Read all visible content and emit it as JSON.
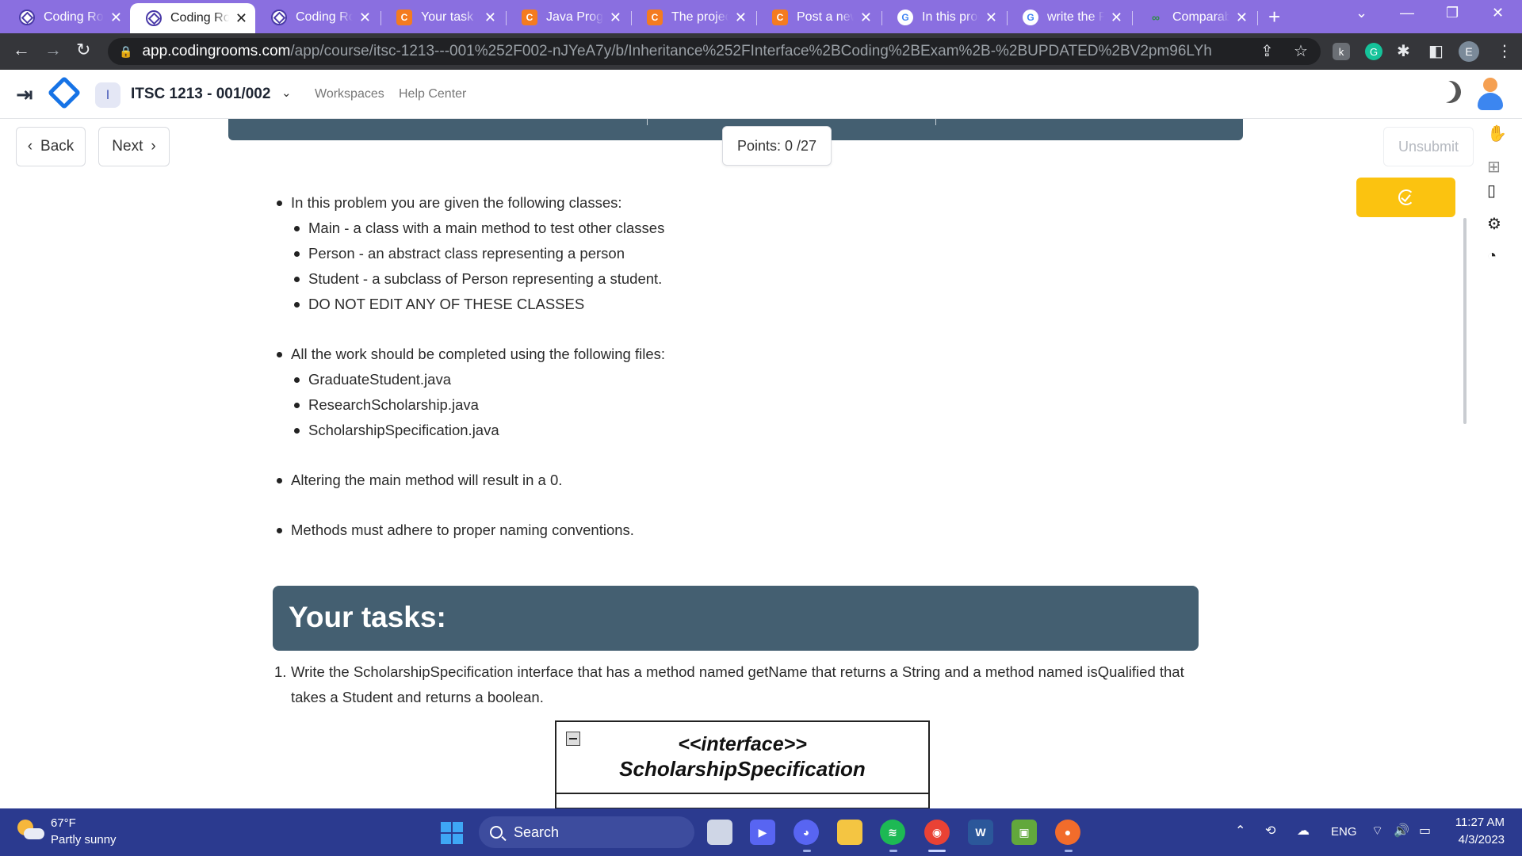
{
  "browser": {
    "tabs": [
      {
        "title": "Coding Rooms",
        "icon": "codingrooms-icon"
      },
      {
        "title": "Coding Rooms",
        "icon": "codingrooms-icon",
        "active": true
      },
      {
        "title": "Coding Rooms",
        "icon": "codingrooms-icon"
      },
      {
        "title": "Your task is",
        "icon": "c-icon"
      },
      {
        "title": "Java Programming",
        "icon": "c-icon"
      },
      {
        "title": "The project",
        "icon": "c-icon"
      },
      {
        "title": "Post a new",
        "icon": "c-icon"
      },
      {
        "title": "In this problem",
        "icon": "google-icon"
      },
      {
        "title": "write the Re",
        "icon": "google-icon"
      },
      {
        "title": "Comparable",
        "icon": "gfg-icon"
      }
    ],
    "close_glyph": "✕",
    "new_tab_glyph": "+",
    "url_host": "app.codingrooms.com",
    "url_path": "/app/course/itsc-1213---001%252F002-nJYeA7y/b/Inheritance%252FInterface%2BCoding%2BExam%2B-%2BUPDATED%2BV2pm96LYh",
    "profile_initial": "E"
  },
  "app": {
    "course_badge": "I",
    "course_title": "ITSC 1213 - 001/002",
    "nav": {
      "workspaces": "Workspaces",
      "help_center": "Help Center"
    },
    "back_label": "Back",
    "next_label": "Next",
    "points_label": "Points: 0 /27",
    "unsubmit_label": "Unsubmit"
  },
  "content": {
    "given": {
      "intro": "In this problem you are given the following classes:",
      "items": [
        "Main - a class with a main method to test other classes",
        "Person - an abstract class representing a person",
        "Student - a subclass of Person representing a student.",
        "DO NOT EDIT ANY OF THESE CLASSES"
      ]
    },
    "files": {
      "intro": "All the work should be completed using the following files:",
      "items": [
        "GraduateStudent.java",
        "ResearchScholarship.java",
        "ScholarshipSpecification.java"
      ]
    },
    "note_main": "Altering the main method will result in a 0.",
    "note_naming": "Methods must adhere to proper naming conventions.",
    "tasks_heading": "Your tasks:",
    "task1_num": "1.",
    "task1_text": "Write the ScholarshipSpecification interface that has a method named getName that returns a String and a method named isQualified that takes a Student and returns a boolean.",
    "uml": {
      "stereotype": "<<interface>>",
      "name": "ScholarshipSpecification"
    }
  },
  "taskbar": {
    "temperature": "67°F",
    "weather": "Partly sunny",
    "search_label": "Search",
    "language": "ENG",
    "time": "11:27 AM",
    "date": "4/3/2023"
  },
  "colors": {
    "tabstrip": "#8a6fe0",
    "banner": "#445f71",
    "check_button": "#fbc310",
    "taskbar": "#2b3a8f"
  }
}
